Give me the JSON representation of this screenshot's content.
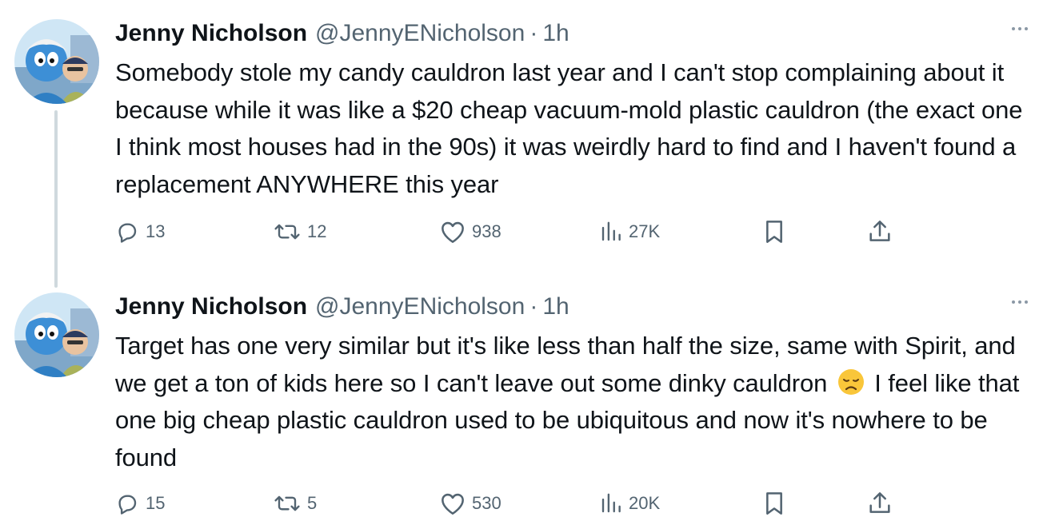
{
  "tweets": [
    {
      "display_name": "Jenny Nicholson",
      "handle": "@JennyENicholson",
      "separator": "·",
      "time": "1h",
      "text": "Somebody stole my candy cauldron last year and I can't stop complaining about it because while it was like a $20 cheap vacuum-mold plastic cauldron (the exact one I think most houses had in the 90s) it was weirdly hard to find and I haven't found a replacement ANYWHERE this year",
      "replies": "13",
      "reposts": "12",
      "likes": "938",
      "views": "27K"
    },
    {
      "display_name": "Jenny Nicholson",
      "handle": "@JennyENicholson",
      "separator": "·",
      "time": "1h",
      "text_before_emoji": "Target has one very similar but it's like less than half the size, same with Spirit, and we get a ton of kids here so I can't leave out some dinky cauldron",
      "emoji": "disappointed-face-emoji",
      "text_after_emoji": "I feel like that one big cheap plastic cauldron used to be ubiquitous and now it's nowhere to be found",
      "replies": "15",
      "reposts": "5",
      "likes": "530",
      "views": "20K"
    }
  ],
  "icons": {
    "reply": "speech-bubble-icon",
    "repost": "repost-arrows-icon",
    "like": "heart-icon",
    "views": "bar-chart-icon",
    "bookmark": "bookmark-icon",
    "share": "share-upload-icon",
    "more": "more-dots-icon"
  },
  "colors": {
    "text_primary": "#0f1419",
    "text_secondary": "#536471",
    "thread_line": "#cfd9de",
    "emoji_yellow": "#f9c63a"
  }
}
